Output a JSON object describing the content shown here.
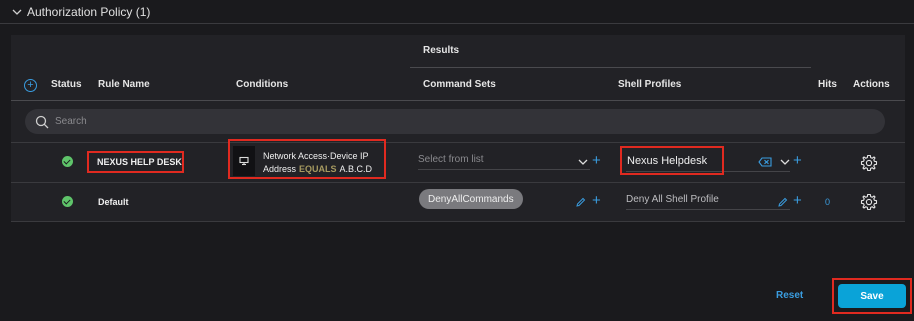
{
  "section": {
    "title": "Authorization Policy (1)",
    "collapse_icon": "chevron-down-icon"
  },
  "table": {
    "results_label": "Results",
    "columns": {
      "status": "Status",
      "rule_name": "Rule Name",
      "conditions": "Conditions",
      "command_sets": "Command Sets",
      "shell_profiles": "Shell Profiles",
      "hits": "Hits",
      "actions": "Actions"
    },
    "search_placeholder": "Search",
    "rows": [
      {
        "status": "enabled",
        "rule_name": "NEXUS HELP DESK",
        "condition_line1": "Network Access·Device IP",
        "condition_attr": "Address",
        "condition_op": "EQUALS",
        "condition_value": "A.B.C.D",
        "command_set_placeholder": "Select from list",
        "shell_profile": "Nexus Helpdesk",
        "hits": ""
      },
      {
        "status": "enabled",
        "rule_name": "Default",
        "command_set": "DenyAllCommands",
        "shell_profile": "Deny All Shell Profile",
        "hits": "0"
      }
    ]
  },
  "footer": {
    "reset_label": "Reset",
    "save_label": "Save"
  },
  "colors": {
    "accent": "#3a9de0",
    "save": "#0aa3d8",
    "status_ok": "#5fc46a",
    "highlight": "#e02a20",
    "operator": "#a69a60"
  }
}
